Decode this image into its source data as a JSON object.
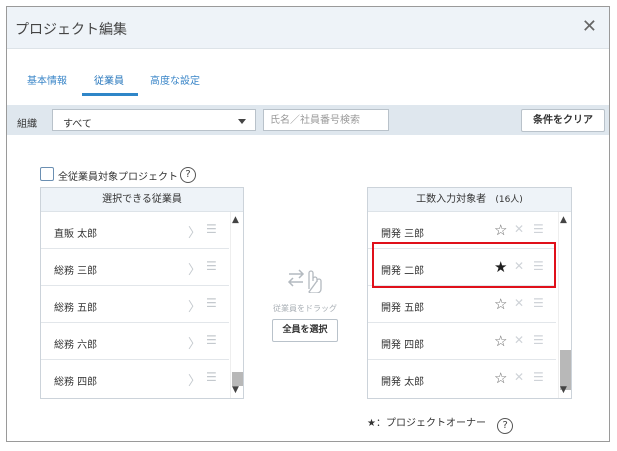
{
  "dialog": {
    "title": "プロジェクト編集",
    "close": "✕"
  },
  "tabs": [
    {
      "label": "基本情報"
    },
    {
      "label": "従業員"
    },
    {
      "label": "高度な設定"
    }
  ],
  "filter": {
    "org_label": "組織",
    "org_value": "すべて",
    "search_placeholder": "氏名／社員番号検索",
    "clear_button": "条件をクリア"
  },
  "all_employee_project": {
    "label": "全従業員対象プロジェクト",
    "help": "?"
  },
  "available": {
    "header": "選択できる従業員",
    "items": [
      {
        "name": "直販 太郎"
      },
      {
        "name": "総務 三郎"
      },
      {
        "name": "総務 五郎"
      },
      {
        "name": "総務 六郎"
      },
      {
        "name": "総務 四郎"
      }
    ]
  },
  "middle": {
    "drag_text": "従業員をドラッグ",
    "select_all": "全員を選択"
  },
  "assigned": {
    "header": "工数入力対象者",
    "count": "(16人)",
    "items": [
      {
        "name": "開発 三郎",
        "owner": false
      },
      {
        "name": "開発 二郎",
        "owner": true
      },
      {
        "name": "開発 五郎",
        "owner": false
      },
      {
        "name": "開発 四郎",
        "owner": false
      },
      {
        "name": "開発 太郎",
        "owner": false
      }
    ]
  },
  "legend": {
    "text": "★：プロジェクトオーナー",
    "help": "?"
  },
  "glyphs": {
    "chevron": "〉",
    "grip": "☰",
    "star_empty": "☆",
    "star_filled": "★",
    "x": "✕",
    "up": "▲",
    "down": "▼"
  },
  "colors": {
    "accent": "#2f86c8",
    "highlight": "#e0101a",
    "header_bg": "#eef3f8",
    "filter_bg": "#dfe7ee"
  }
}
